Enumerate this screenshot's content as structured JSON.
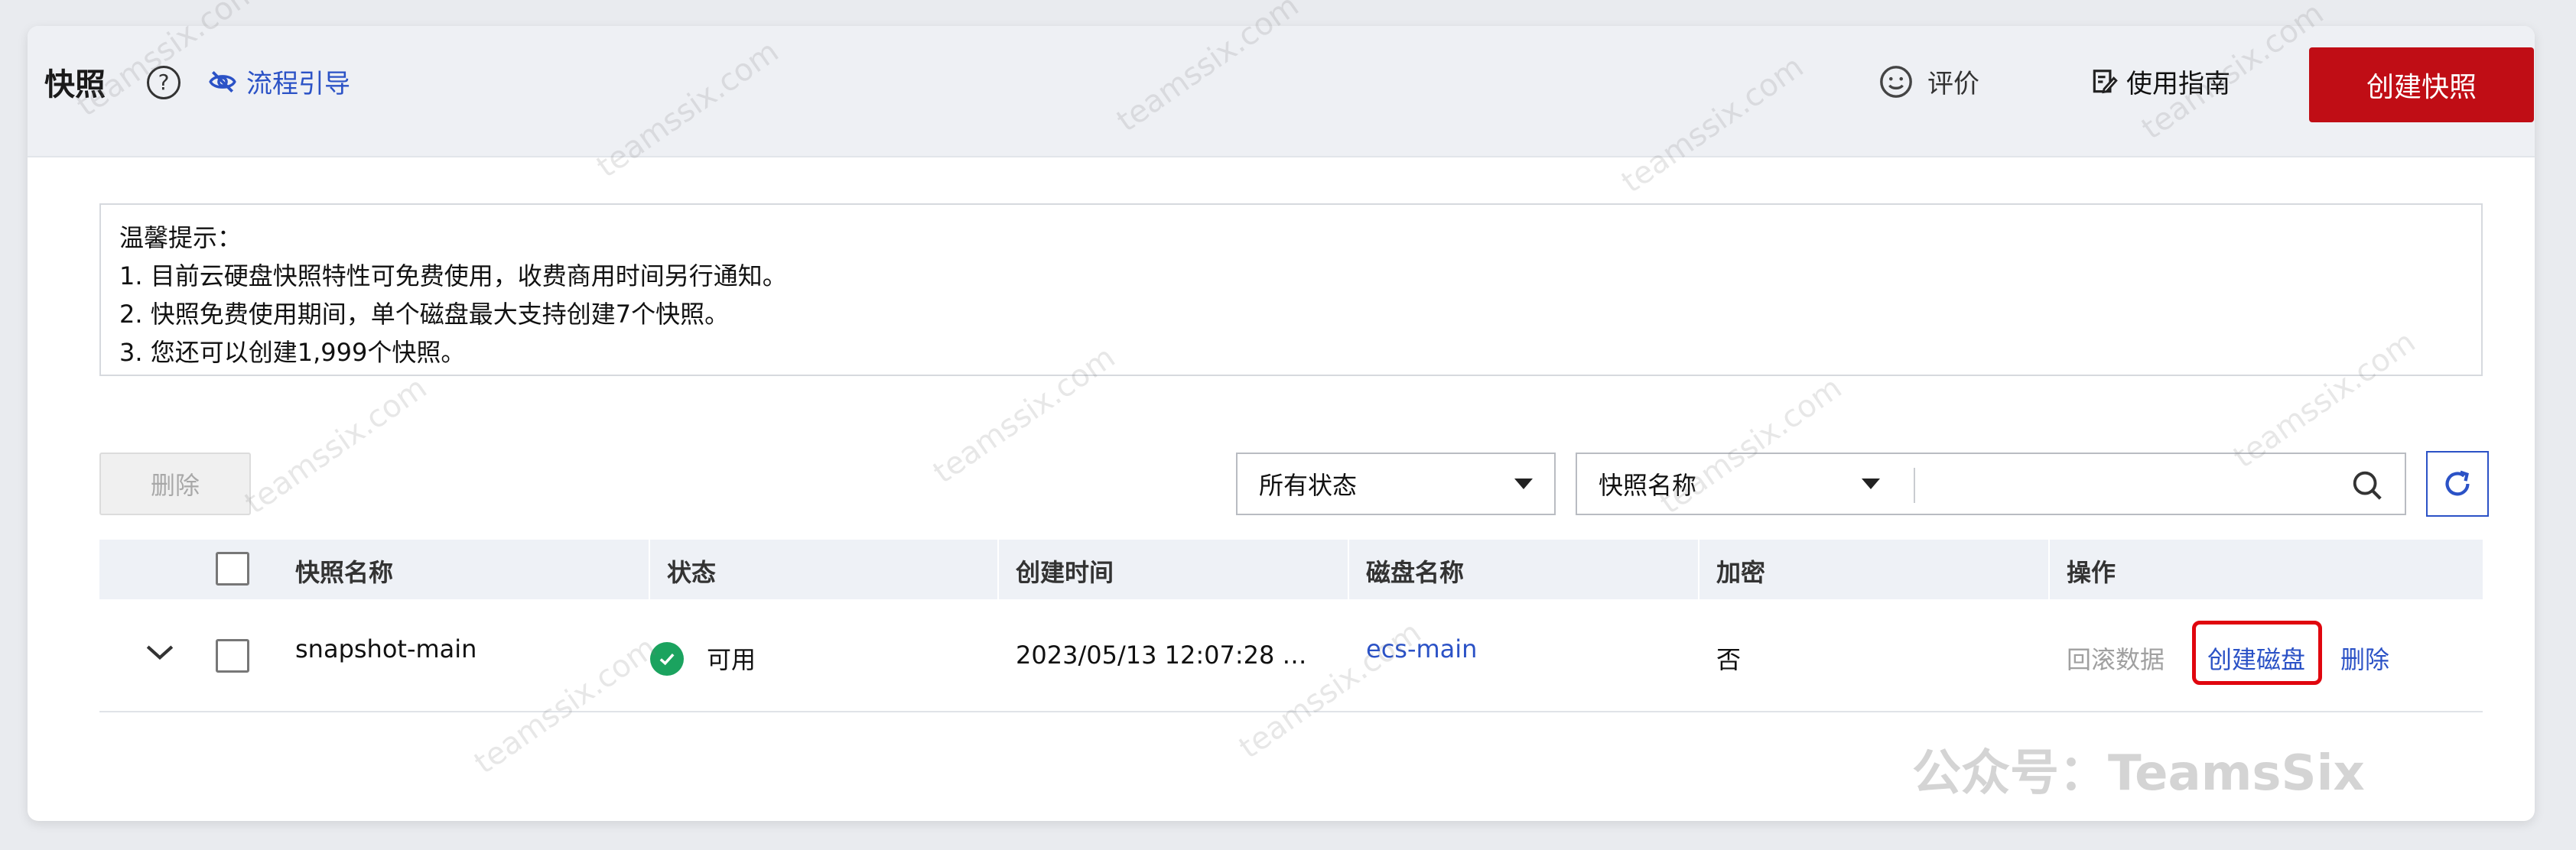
{
  "header": {
    "title": "快照",
    "help_icon": "?",
    "guide_label": "流程引导",
    "rate_label": "评价",
    "manual_label": "使用指南",
    "create_button": "创建快照"
  },
  "tips": {
    "heading": "温馨提示：",
    "lines": [
      "1. 目前云硬盘快照特性可免费使用，收费商用时间另行通知。",
      "2. 快照免费使用期间，单个磁盘最大支持创建7个快照。",
      "3. 您还可以创建1,999个快照。"
    ]
  },
  "toolbar": {
    "delete_button": "删除",
    "status_filter": "所有状态",
    "field_filter": "快照名称",
    "search_value": ""
  },
  "table": {
    "headers": [
      "快照名称",
      "状态",
      "创建时间",
      "磁盘名称",
      "加密",
      "操作"
    ],
    "rows": [
      {
        "name": "snapshot-main",
        "status": "可用",
        "created": "2023/05/13 12:07:28 …",
        "disk": "ecs-main",
        "encrypted": "否",
        "actions": [
          "回滚数据",
          "创建磁盘",
          "删除"
        ]
      }
    ]
  },
  "watermark": {
    "text": "teamssix.com",
    "brand": "公众号：TeamsSix"
  },
  "colors": {
    "primary_red": "#c00d15",
    "link_blue": "#2b52c6",
    "status_green": "#1ba35f",
    "highlight_red": "#e0060e"
  }
}
